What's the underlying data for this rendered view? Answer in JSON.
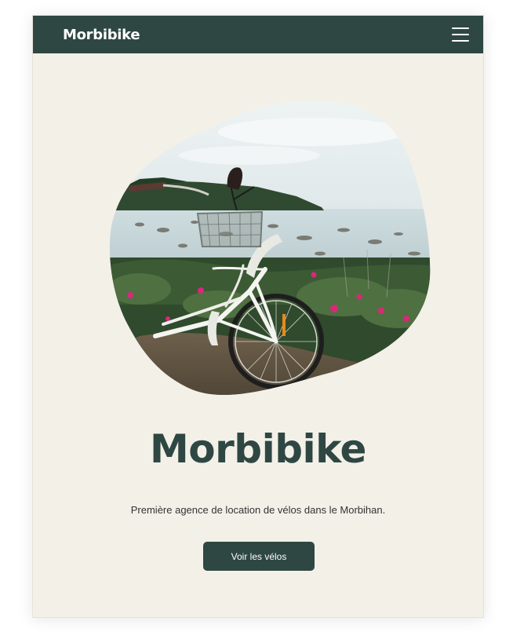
{
  "navbar": {
    "brand": "Morbibike",
    "menu_icon": "hamburger-menu-icon"
  },
  "hero": {
    "image_icon": "bicycle-seaside-photo",
    "title": "Morbibike",
    "subtitle": "Première agence de location de vélos dans le Morbihan.",
    "cta_label": "Voir les vélos"
  },
  "colors": {
    "primary": "#2e4742",
    "background": "#f3f0e8",
    "text": "#333333",
    "on_primary": "#ffffff"
  }
}
